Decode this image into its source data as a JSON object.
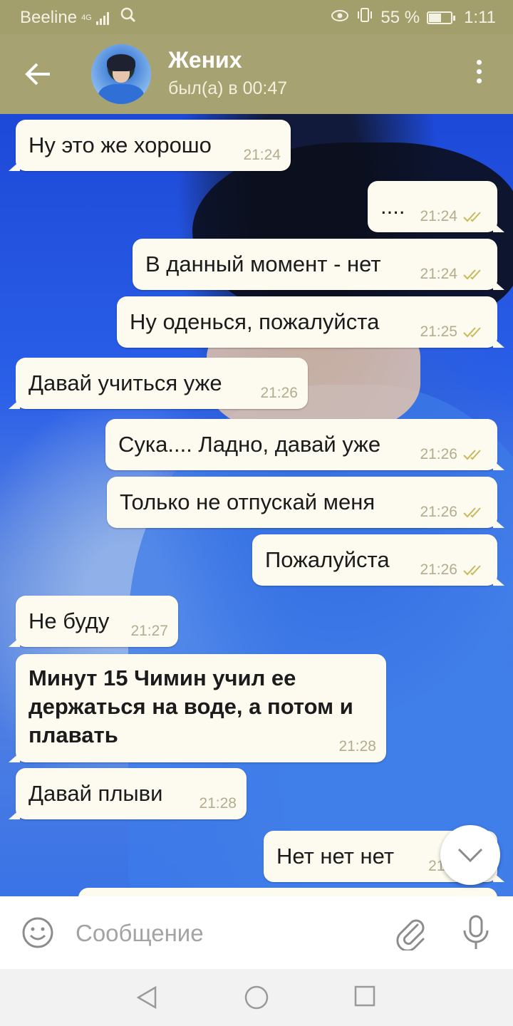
{
  "status_bar": {
    "carrier": "Beeline",
    "network": "4G",
    "battery": "55 %",
    "battery_level": 0.55,
    "time": "1:11"
  },
  "header": {
    "contact_name": "Жених",
    "last_seen": "был(а) в 00:47"
  },
  "messages": [
    {
      "dir": "in",
      "text": "Ну это же хорошо",
      "time": "21:24"
    },
    {
      "dir": "out",
      "text": "....",
      "time": "21:24",
      "read": true
    },
    {
      "dir": "out",
      "text": "В данный момент - нет",
      "time": "21:24",
      "read": true
    },
    {
      "dir": "out",
      "text": "Ну оденься, пожалуйста",
      "time": "21:25",
      "read": true
    },
    {
      "dir": "in",
      "text": "Давай учиться уже",
      "time": "21:26"
    },
    {
      "dir": "out",
      "text": "Сука.... Ладно, давай уже",
      "time": "21:26",
      "read": true
    },
    {
      "dir": "out",
      "text": "Только не отпускай меня",
      "time": "21:26",
      "read": true
    },
    {
      "dir": "out",
      "text": "Пожалуйста",
      "time": "21:26",
      "read": true
    },
    {
      "dir": "in",
      "text": "Не буду",
      "time": "21:27"
    },
    {
      "dir": "in",
      "text": "Минут 15 Чимин учил ее держаться на воде, а потом и плавать",
      "time": "21:28"
    },
    {
      "dir": "in",
      "text": "Давай плыви",
      "time": "21:28"
    },
    {
      "dir": "out",
      "text": "Нет нет нет",
      "time": "21:2",
      "read": true
    }
  ],
  "input": {
    "placeholder": "Сообщение"
  },
  "colors": {
    "header": "#a7a272",
    "status_bar": "#a39f6c",
    "bubble": "#fdfaf0",
    "tick": "#c9b95a",
    "time_text": "#b3ad8e"
  },
  "icons": [
    "back-arrow-icon",
    "more-vert-icon",
    "double-check-icon",
    "chevron-down-icon",
    "emoji-icon",
    "paperclip-icon",
    "mic-icon",
    "nav-back-icon",
    "nav-home-icon",
    "nav-recent-icon",
    "signal-icon",
    "search-icon",
    "eye-icon",
    "vibrate-icon",
    "battery-icon"
  ]
}
